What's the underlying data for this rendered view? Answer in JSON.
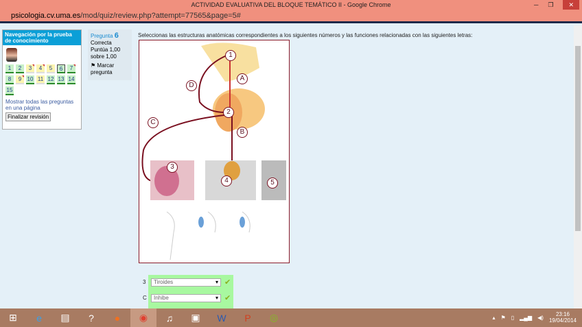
{
  "window": {
    "title": "ACTIVIDAD EVALUATIVA DEL BLOQUE TEMÁTICO II - Google Chrome",
    "url_host": "psicologia.cv.uma.es",
    "url_path": "/mod/quiz/review.php?attempt=77565&page=5#"
  },
  "nav": {
    "title": "Navegación por la prueba de conocimiento",
    "questions": [
      {
        "n": "1",
        "state": "c"
      },
      {
        "n": "2",
        "state": "c"
      },
      {
        "n": "3",
        "state": "y f"
      },
      {
        "n": "4",
        "state": "y f"
      },
      {
        "n": "5",
        "state": "y"
      },
      {
        "n": "6",
        "state": "c cur"
      },
      {
        "n": "7",
        "state": "c f"
      },
      {
        "n": "8",
        "state": "c"
      },
      {
        "n": "9",
        "state": "y f"
      },
      {
        "n": "10",
        "state": "c"
      },
      {
        "n": "11",
        "state": "y"
      },
      {
        "n": "12",
        "state": "c"
      },
      {
        "n": "13",
        "state": "c"
      },
      {
        "n": "14",
        "state": "c"
      },
      {
        "n": "15",
        "state": "c"
      }
    ],
    "show_all": "Mostrar todas las preguntas en una página",
    "finish": "Finalizar revisión"
  },
  "info": {
    "label": "Pregunta",
    "number": "6",
    "status": "Correcta",
    "score": "Puntúa 1,00 sobre 1,00",
    "flag": "Marcar pregunta"
  },
  "question": "Seleccionas las estructuras anatómicas correspondientes a los siguientes números y las funciones relacionadas con las siguientes letras:",
  "figure_labels": [
    "1",
    "2",
    "3",
    "4",
    "5",
    "A",
    "B",
    "C",
    "D"
  ],
  "answers": [
    {
      "key": "3",
      "value": "Tiroides"
    },
    {
      "key": "C",
      "value": "Inhibe"
    }
  ],
  "tray": {
    "time": "23:16",
    "date": "19/04/2014"
  }
}
